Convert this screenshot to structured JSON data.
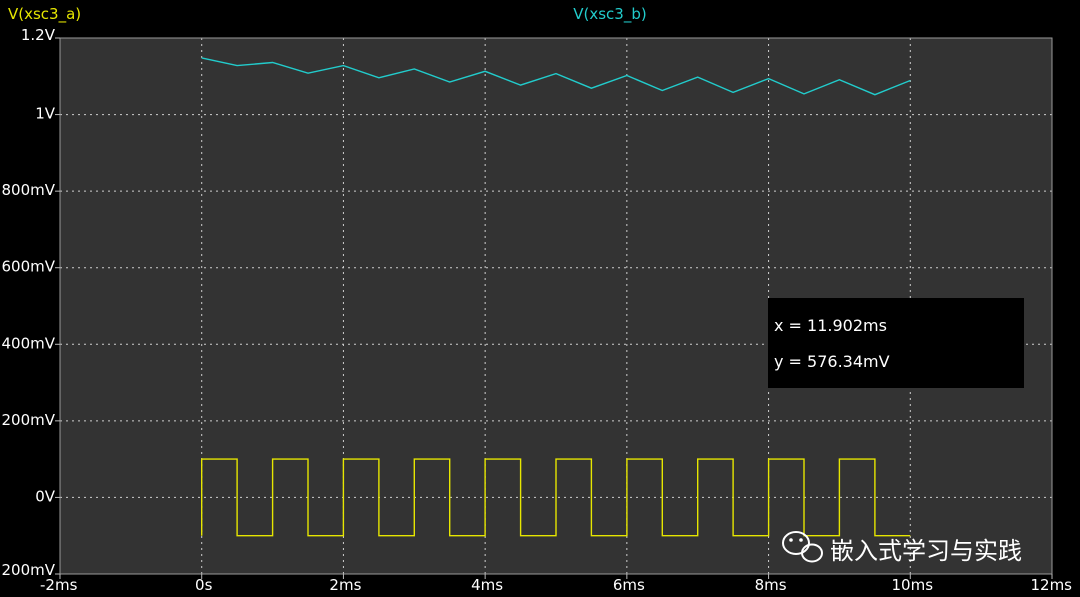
{
  "chart_data": {
    "type": "line",
    "legend": [
      "V(xsc3_a)",
      "V(xsc3_b)"
    ],
    "x_ticks": [
      "-2ms",
      "0s",
      "2ms",
      "4ms",
      "6ms",
      "8ms",
      "10ms",
      "12ms"
    ],
    "y_ticks": [
      "1.2V",
      "1V",
      "800mV",
      "600mV",
      "400mV",
      "200mV",
      "0V",
      "200mV"
    ],
    "xlim": [
      -2,
      12
    ],
    "ylim": [
      -0.2,
      1.2
    ],
    "x_unit": "ms",
    "grid": true,
    "series": [
      {
        "name": "V(xsc3_a)",
        "color": "#e6e600",
        "step": true,
        "x": [
          0,
          0,
          0.5,
          0.5,
          1.0,
          1.0,
          1.5,
          1.5,
          2.0,
          2.0,
          2.5,
          2.5,
          3.0,
          3.0,
          3.5,
          3.5,
          4.0,
          4.0,
          4.5,
          4.5,
          5.0,
          5.0,
          5.5,
          5.5,
          6.0,
          6.0,
          6.5,
          6.5,
          7.0,
          7.0,
          7.5,
          7.5,
          8.0,
          8.0,
          8.5,
          8.5,
          9.0,
          9.0,
          9.5,
          9.5,
          10.0
        ],
        "y": [
          -0.1,
          0.1,
          0.1,
          -0.1,
          -0.1,
          0.1,
          0.1,
          -0.1,
          -0.1,
          0.1,
          0.1,
          -0.1,
          -0.1,
          0.1,
          0.1,
          -0.1,
          -0.1,
          0.1,
          0.1,
          -0.1,
          -0.1,
          0.1,
          0.1,
          -0.1,
          -0.1,
          0.1,
          0.1,
          -0.1,
          -0.1,
          0.1,
          0.1,
          -0.1,
          -0.1,
          0.1,
          0.1,
          -0.1,
          -0.1,
          0.1,
          0.1,
          -0.1,
          -0.1
        ]
      },
      {
        "name": "V(xsc3_b)",
        "color": "#22cccc",
        "x": [
          0,
          0.5,
          1.0,
          1.5,
          2.0,
          2.5,
          3.0,
          3.5,
          4.0,
          4.5,
          5.0,
          5.5,
          6.0,
          6.5,
          7.0,
          7.5,
          8.0,
          8.5,
          9.0,
          9.5,
          10.0
        ],
        "y": [
          1.148,
          1.128,
          1.136,
          1.108,
          1.128,
          1.096,
          1.119,
          1.085,
          1.113,
          1.077,
          1.107,
          1.069,
          1.102,
          1.063,
          1.098,
          1.058,
          1.094,
          1.054,
          1.091,
          1.052,
          1.089
        ]
      }
    ],
    "annotations": {
      "x": "x = 11.902ms",
      "y": "y = 576.34mV"
    }
  },
  "watermark": "嵌入式学习与实践",
  "watermark_icon": "wechat-icon"
}
